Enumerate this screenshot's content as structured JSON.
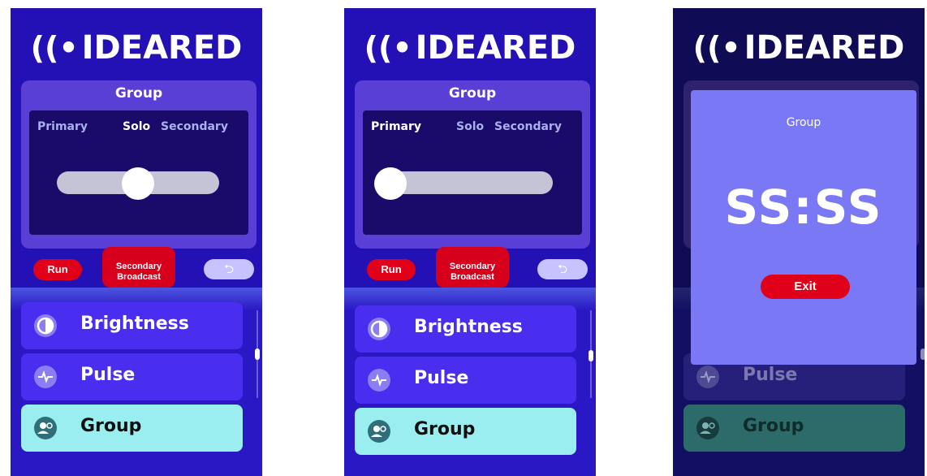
{
  "logo": {
    "mark": "((•",
    "text": "IDEARED"
  },
  "screens": [
    {
      "group_title": "Group",
      "modes": [
        "Primary",
        "Solo",
        "Secondary"
      ],
      "active_mode": "Solo",
      "slider_level": 0.5,
      "run_label": "Run",
      "broadcast_label_line1": "Secondary",
      "broadcast_label_line2": "Broadcast",
      "back_icon": "undo-arrow-icon",
      "menu": [
        {
          "label": "Brightness",
          "icon": "contrast-icon"
        },
        {
          "label": "Pulse",
          "icon": "pulse-icon"
        },
        {
          "label": "Group",
          "icon": "group-users-icon",
          "selected": true
        }
      ]
    },
    {
      "group_title": "Group",
      "modes": [
        "Primary",
        "Solo",
        "Secondary"
      ],
      "active_mode": "Primary",
      "slider_level": 0.0,
      "run_label": "Run",
      "broadcast_label_line1": "Secondary",
      "broadcast_label_line2": "Broadcast",
      "back_icon": "undo-arrow-icon",
      "menu": [
        {
          "label": "Brightness",
          "icon": "contrast-icon"
        },
        {
          "label": "Pulse",
          "icon": "pulse-icon"
        },
        {
          "label": "Group",
          "icon": "group-users-icon",
          "selected": true
        }
      ]
    },
    {
      "modal": {
        "title": "Group",
        "time": "SS:SS",
        "exit_label": "Exit"
      },
      "menu": [
        {
          "label": "Pulse",
          "icon": "pulse-icon"
        },
        {
          "label": "Group",
          "icon": "group-users-icon",
          "selected": true
        }
      ]
    }
  ],
  "colors": {
    "background": "#2411b6",
    "panel": "#5a3fd6",
    "inner_panel": "#1a0b6a",
    "run": "#e0001a",
    "selected_item": "#9aeef0",
    "modal": "#7a78f5"
  }
}
